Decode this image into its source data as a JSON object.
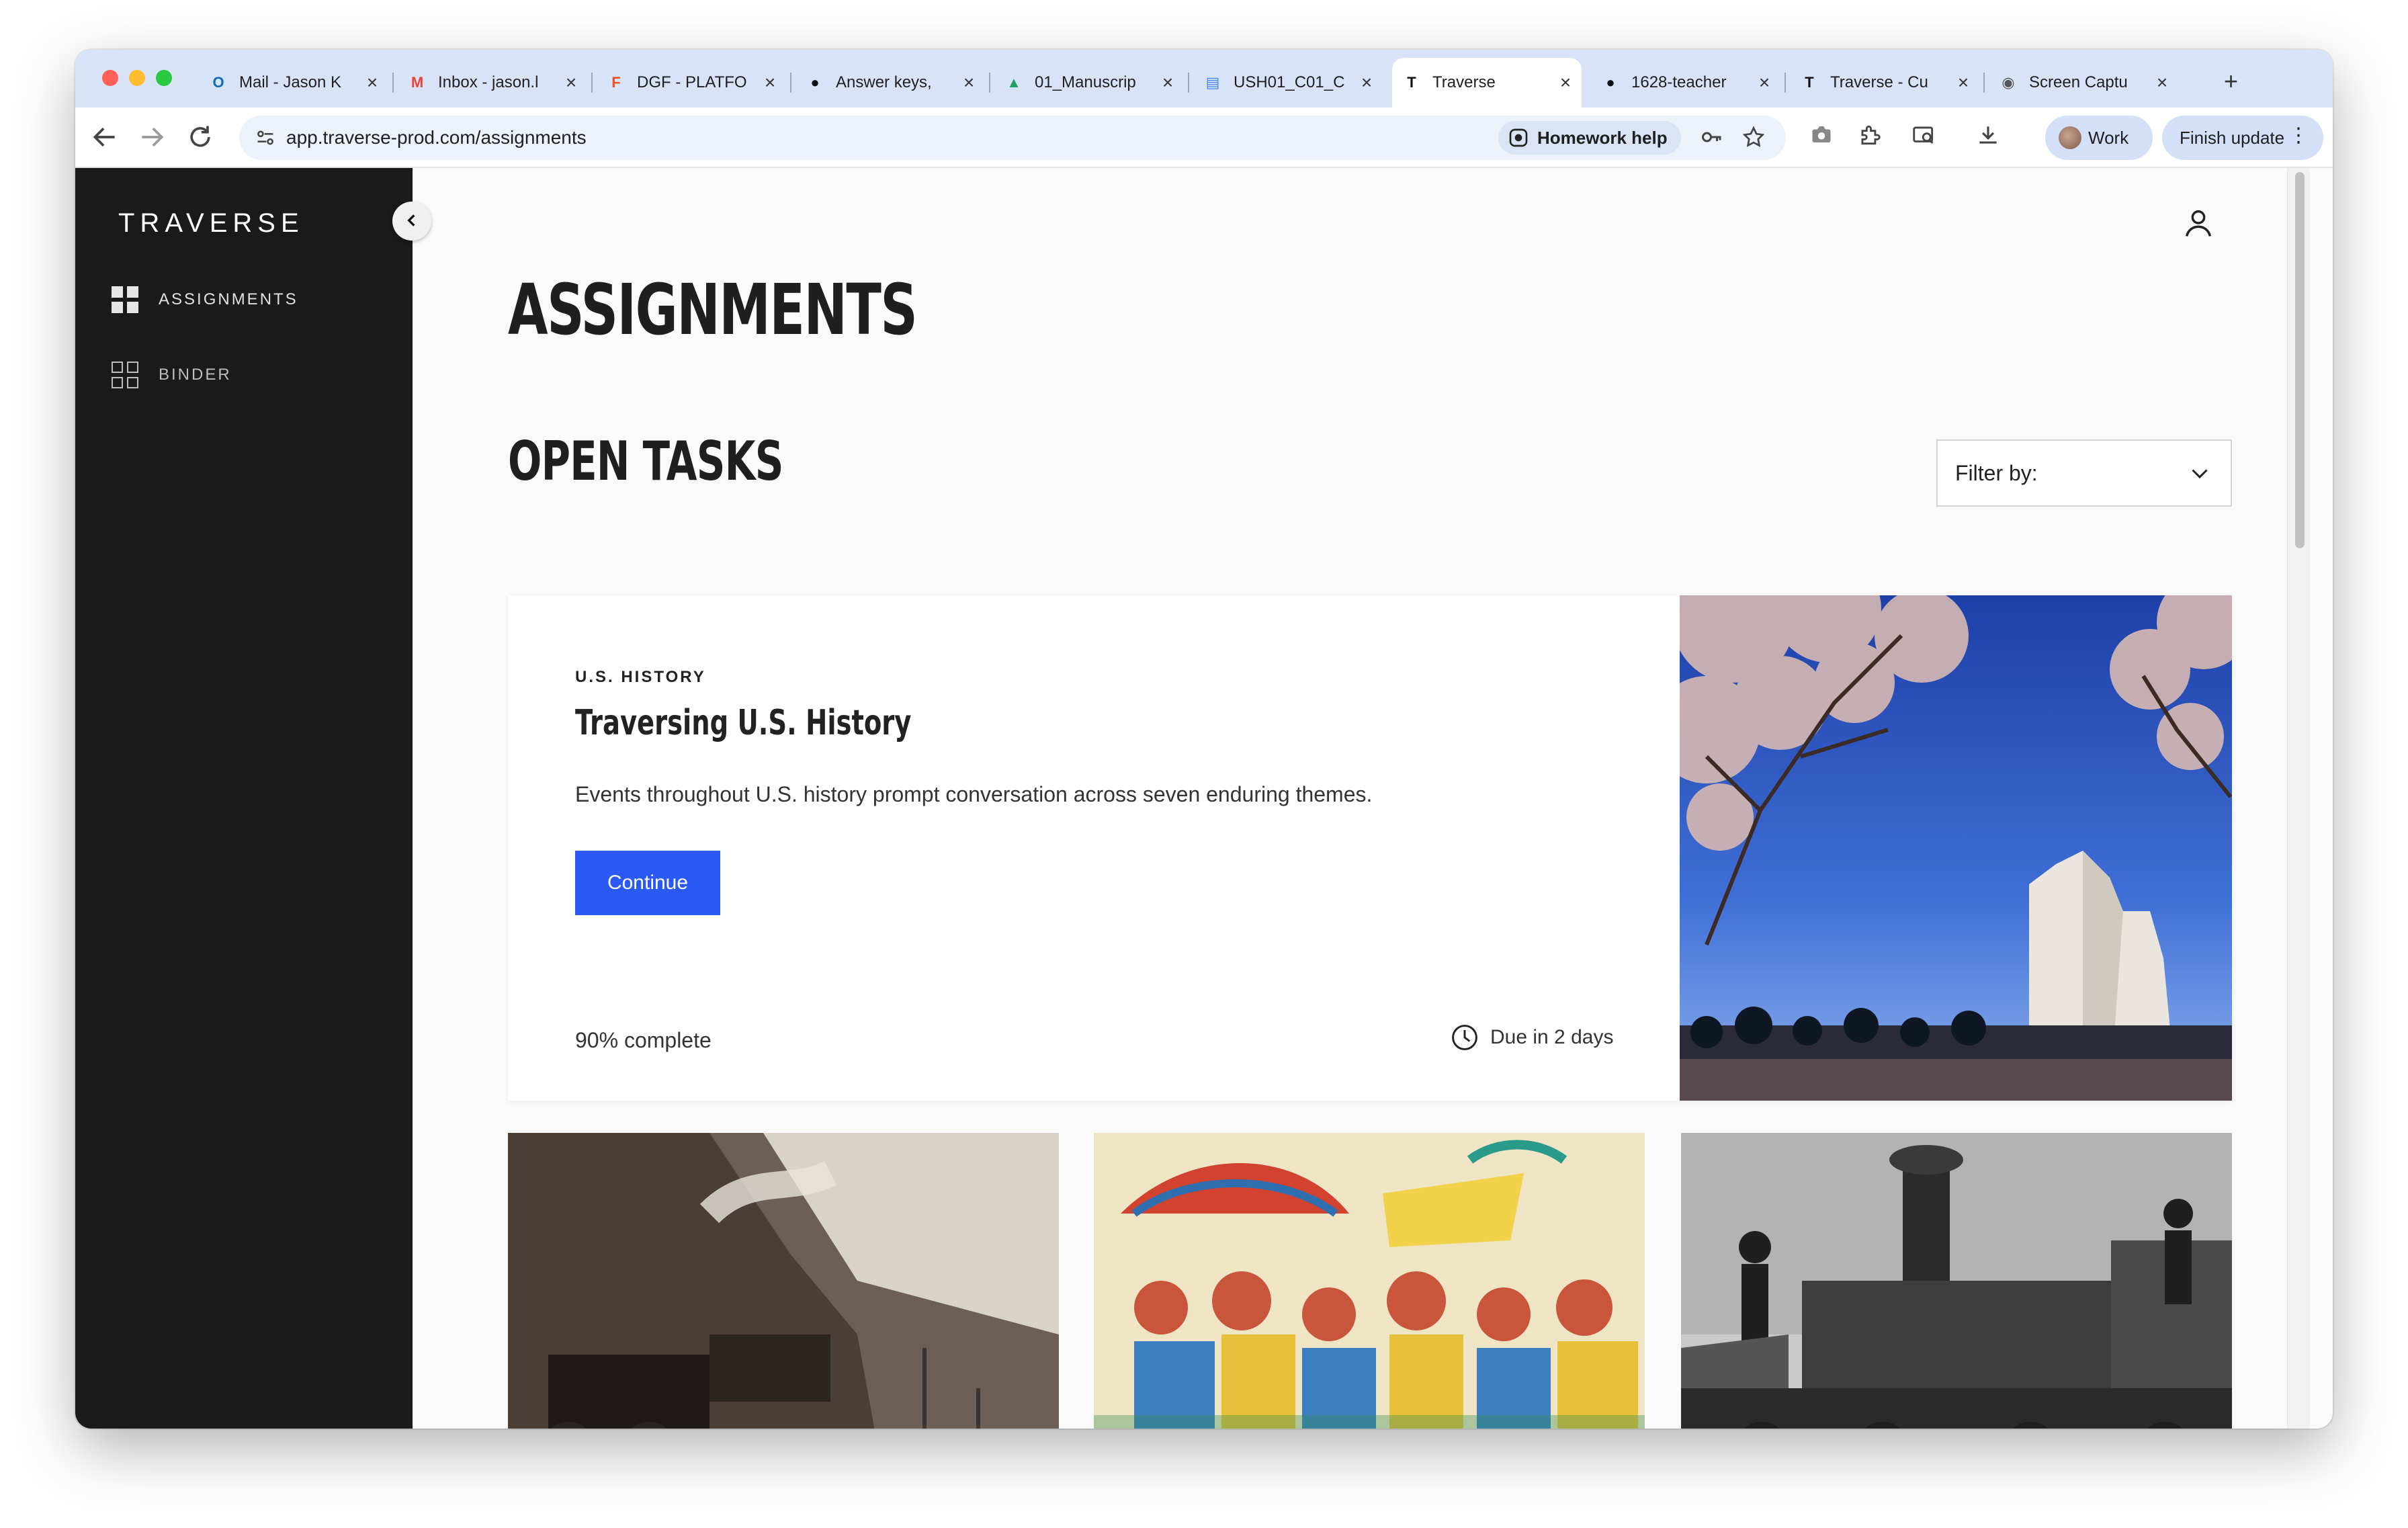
{
  "browser": {
    "tabs": [
      {
        "label": "Mail - Jason K",
        "icon": "outlook-icon",
        "color": "#0f6cbd"
      },
      {
        "label": "Inbox - jason.l",
        "icon": "gmail-icon",
        "color": "#ea4335"
      },
      {
        "label": "DGF - PLATFO",
        "icon": "figma-icon",
        "color": "#f24e1e"
      },
      {
        "label": "Answer keys, ",
        "icon": "github-icon",
        "color": "#111111"
      },
      {
        "label": "01_Manuscrip",
        "icon": "drive-icon",
        "color": "#1fa463"
      },
      {
        "label": "USH01_C01_C",
        "icon": "docs-icon",
        "color": "#4285f4"
      },
      {
        "label": "Traverse",
        "icon": "traverse-icon",
        "color": "#111111",
        "active": true
      },
      {
        "label": "1628-teacher",
        "icon": "github-icon",
        "color": "#111111"
      },
      {
        "label": "Traverse - Cu",
        "icon": "traverse-icon",
        "color": "#111111"
      },
      {
        "label": "Screen Captu",
        "icon": "camera-icon",
        "color": "#555555"
      }
    ],
    "url": "app.traverse-prod.com/assignments",
    "homework_help": "Homework help",
    "profile_label": "Work",
    "finish_update": "Finish update"
  },
  "app": {
    "logo": "TRAVERSE",
    "sidebar": {
      "items": [
        {
          "label": "ASSIGNMENTS",
          "active": true
        },
        {
          "label": "BINDER",
          "active": false
        }
      ]
    },
    "page_title": "ASSIGNMENTS",
    "section_title": "OPEN TASKS",
    "filter_label": "Filter by:",
    "card": {
      "eyebrow": "U.S. HISTORY",
      "title": "Traversing U.S. History",
      "description": "Events throughout U.S. history prompt conversation across seven enduring themes.",
      "button": "Continue",
      "progress": "90% complete",
      "progress_value": 0.9,
      "due": "Due in 2 days"
    },
    "colors": {
      "accent": "#2b59f5",
      "sidebar": "#1a1a1a"
    }
  }
}
